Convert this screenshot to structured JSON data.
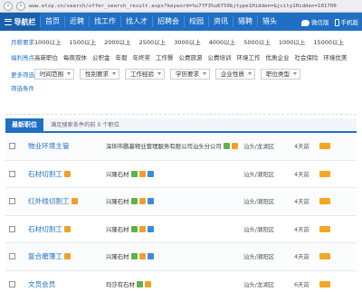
{
  "browser": {
    "url": "www.etzp.cn/search/offer_search_result.aspx?keyword=%u77F3%u6750&jtype1Hidden=&jcity1Hidden=101700"
  },
  "topnav": {
    "menu_label": "导航栏",
    "links": [
      "首页",
      "近聘",
      "找工作",
      "找人才",
      "招聘会",
      "校园",
      "资讯",
      "猎聘",
      "猎头"
    ],
    "wechat_label": "微信版",
    "mobile_label": "手机版"
  },
  "filters": {
    "salary": {
      "label": "月薪要求",
      "options": [
        "1000以上",
        "1500以上",
        "2000以上",
        "2500以上",
        "3000以上",
        "4000以上",
        "5000以上",
        "1000以上",
        "15000以上"
      ]
    },
    "benefits": {
      "label": "福利亮点",
      "options": [
        "高新职位",
        "每周双休",
        "公积金",
        "年假",
        "年终奖",
        "工作餐",
        "公费旅游",
        "公费培训",
        "环境工作",
        "优质企业",
        "社会保险",
        "环境优美"
      ]
    }
  },
  "more": {
    "label": "更多筛选",
    "buttons": [
      "时间范围",
      "性别要求",
      "工作经验",
      "学历要求",
      "企业性质",
      "职位类型"
    ]
  },
  "conditions": {
    "label": "筛选条件"
  },
  "results": {
    "tab_label": "最新职位",
    "note": "满足搜索条件的前 0 个职位"
  },
  "jobs": [
    {
      "title": "物业环境主管",
      "company": "深圳市鹏基物业管理服务有限公司汕头分公司",
      "location": "汕头/龙湖区",
      "time": "4天前"
    },
    {
      "title": "石材切割工",
      "company": "兴隆石材",
      "location": "汕头/潮阳区",
      "time": "4天前"
    },
    {
      "title": "红外线切割工",
      "company": "兴隆石材",
      "location": "汕头/潮阳区",
      "time": "4天前"
    },
    {
      "title": "石材切割工",
      "company": "兴隆石材",
      "location": "汕头/潮阳区",
      "time": "4天前"
    },
    {
      "title": "复合磨薄工",
      "company": "兴隆石材",
      "location": "汕头/潮阳区",
      "time": "4天前"
    },
    {
      "title": "文员会员",
      "company": "玛莎有石材",
      "location": "汕头/龙湖区",
      "time": "6天前"
    }
  ],
  "colors": {
    "brand_blue": "#1f6fc4",
    "accent_orange": "#f5a623"
  }
}
